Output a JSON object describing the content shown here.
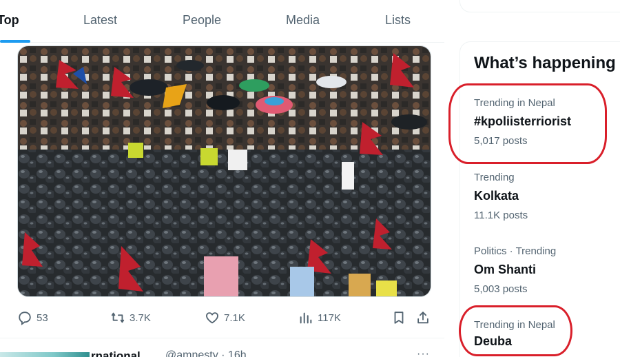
{
  "tabs": [
    "Top",
    "Latest",
    "People",
    "Media",
    "Lists"
  ],
  "tweet": {
    "actions": {
      "replies": "53",
      "retweets": "3.7K",
      "likes": "7.1K",
      "views": "117K"
    }
  },
  "next_tweet": {
    "name": "rnational",
    "handle": "@amnesty · 16h",
    "more": "···"
  },
  "sidebar": {
    "title": "What’s happening",
    "trends": [
      {
        "meta": "Trending in Nepal",
        "name": "#kpoliisterriorist",
        "count": "5,017 posts"
      },
      {
        "meta": "Trending",
        "name": "Kolkata",
        "count": "11.1K posts"
      },
      {
        "meta": "Politics · Trending",
        "name": "Om Shanti",
        "count": "5,003 posts"
      },
      {
        "meta": "Trending in Nepal",
        "name": "Deuba",
        "count": ""
      }
    ]
  },
  "colors": {
    "accent": "#1d9bf0",
    "annotation": "#d91f2a",
    "secondary_text": "#536471"
  },
  "icons": [
    "reply-icon",
    "retweet-icon",
    "like-icon",
    "views-icon",
    "bookmark-icon",
    "share-icon"
  ]
}
